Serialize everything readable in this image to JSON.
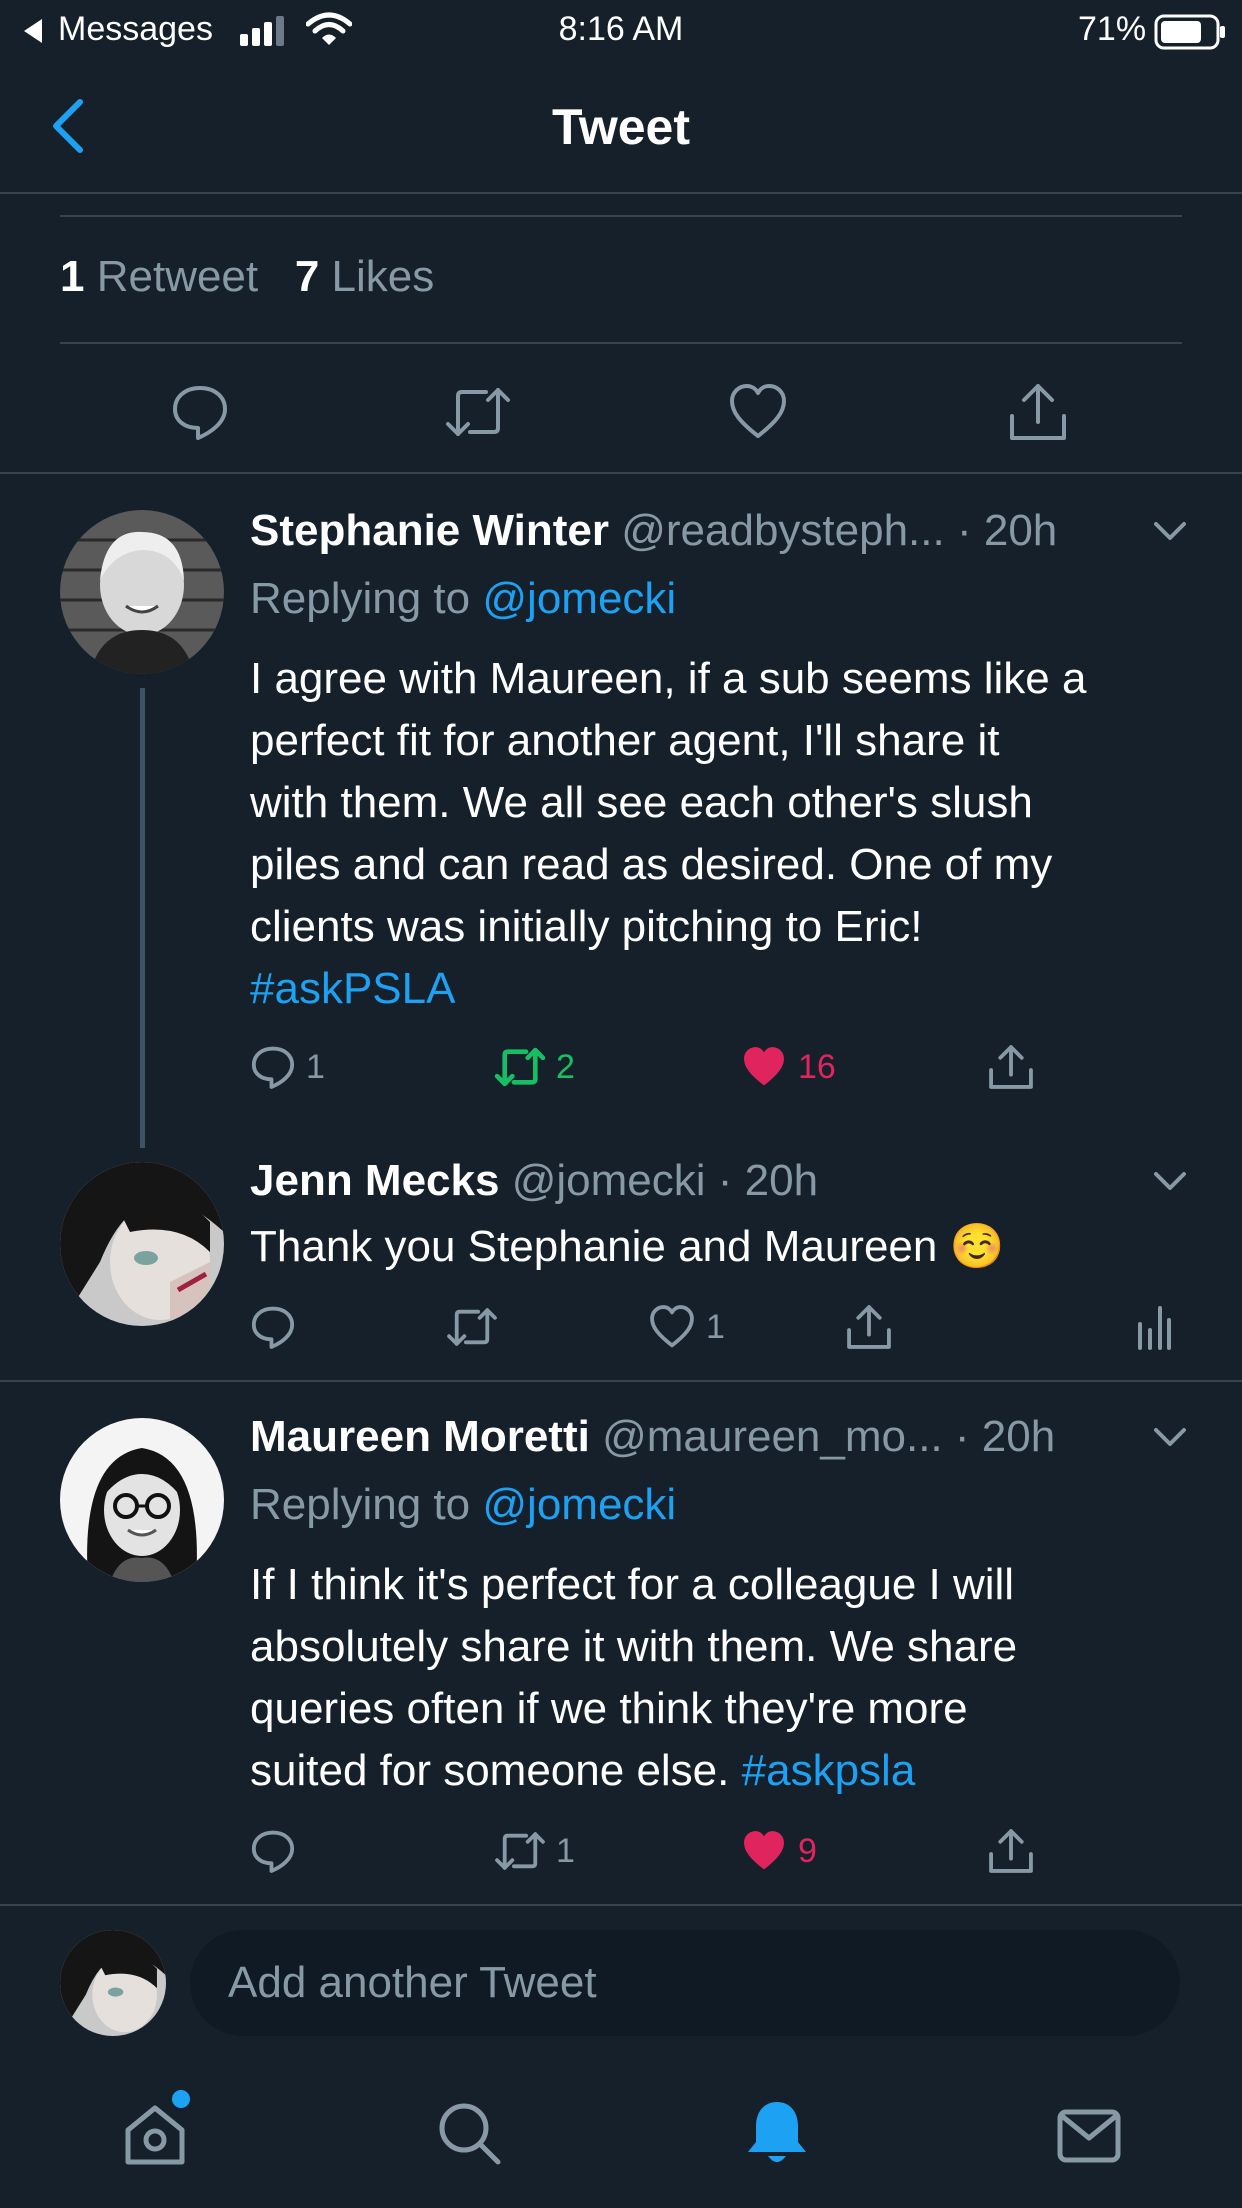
{
  "status_bar": {
    "back_app": "Messages",
    "time": "8:16 AM",
    "battery": "71%"
  },
  "nav": {
    "title": "Tweet"
  },
  "counts": {
    "retweets_num": "1",
    "retweets_label": "Retweet",
    "likes_num": "7",
    "likes_label": "Likes"
  },
  "tweets": [
    {
      "name": "Stephanie Winter",
      "handle": "@readbysteph...",
      "time": "· 20h",
      "replying_prefix": "Replying to",
      "replying_handle": "@jomecki",
      "lines": [
        "I agree with Maureen, if a sub seems like a",
        "perfect fit for another agent, I'll share it",
        "with them. We all see each other's slush",
        "piles and can read as desired. One of my",
        "clients was initially pitching to Eric!"
      ],
      "hashtag": "#askPSLA",
      "replies": "1",
      "retweets": "2",
      "likes": "16"
    },
    {
      "name": "Jenn Mecks",
      "handle": "@jomecki",
      "time": "· 20h",
      "text": "Thank you Stephanie and Maureen",
      "emoji": "☺️",
      "likes": "1"
    },
    {
      "name": "Maureen Moretti",
      "handle": "@maureen_mo...",
      "time": "· 20h",
      "replying_prefix": "Replying to",
      "replying_handle": "@jomecki",
      "lines": [
        "If I think it's perfect for a colleague I will",
        "absolutely share it with them. We share",
        "queries often if we think they're more"
      ],
      "last_line": "suited for someone else.",
      "hashtag": "#askpsla",
      "retweets": "1",
      "likes": "9"
    }
  ],
  "compose": {
    "placeholder": "Add another Tweet"
  },
  "tab_bar": [
    "home-icon",
    "search-icon",
    "bell-icon",
    "mail-icon"
  ],
  "colors": {
    "background": "#15202b",
    "accent": "#1da1f2",
    "like": "#e0245e",
    "retweet": "#17bf63",
    "muted": "#8899a6"
  }
}
